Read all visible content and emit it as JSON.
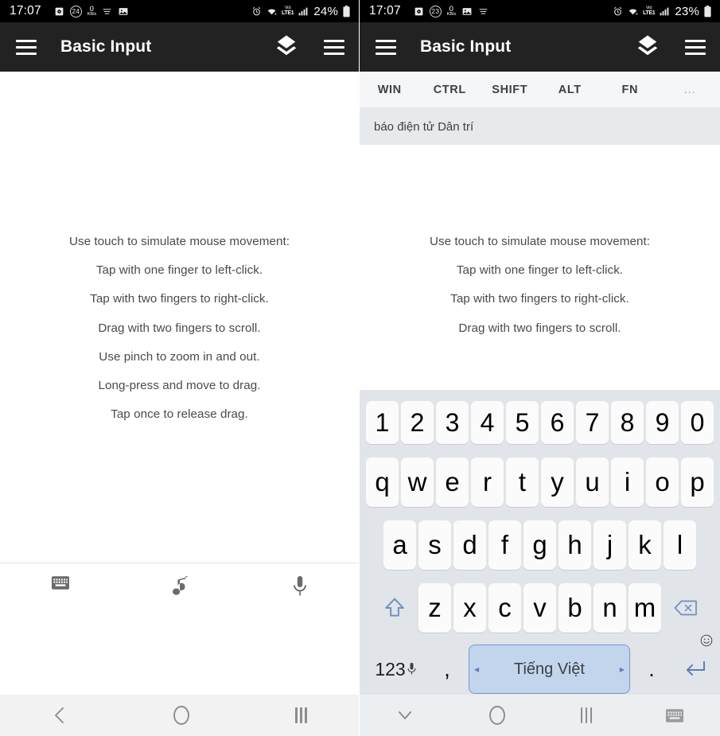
{
  "left": {
    "statusbar": {
      "time": "17:07",
      "alarm_icon": "alarm-clock-icon",
      "badge_count": "24",
      "net_speed_value": "0",
      "net_speed_unit": "KB/s",
      "menu_icon": "list-icon",
      "image_icon": "image-icon",
      "right_alarm_icon": "alarm-icon",
      "wifi_icon": "wifi-icon",
      "volte_top": "Vo)",
      "volte_bottom": "LTE1",
      "signal_icon": "signal-bars-icon",
      "battery_percent": "24%",
      "battery_icon": "battery-icon"
    },
    "appbar": {
      "menu_icon": "hamburger-menu-icon",
      "title": "Basic Input",
      "layers_icon": "layers-icon",
      "overflow_icon": "hamburger-menu-icon"
    },
    "instructions": [
      "Use touch to simulate mouse movement:",
      "Tap with one finger to left-click.",
      "Tap with two fingers to right-click.",
      "Drag with two fingers to scroll.",
      "Use pinch to zoom in and out.",
      "Long-press and move to drag.",
      "Tap once to release drag."
    ],
    "media_toolbar": {
      "keyboard_icon": "keyboard-icon",
      "music_icon": "music-note-icon",
      "mic_icon": "microphone-icon"
    },
    "navbar": {
      "back_icon": "back-chevron-icon",
      "home_icon": "home-circle-icon",
      "recents_icon": "recents-icon"
    }
  },
  "right": {
    "statusbar": {
      "time": "17:07",
      "alarm_icon": "alarm-clock-icon",
      "badge_count": "23",
      "net_speed_value": "0",
      "net_speed_unit": "KB/s",
      "image_icon": "image-icon",
      "menu_icon": "list-icon",
      "right_alarm_icon": "alarm-icon",
      "wifi_icon": "wifi-icon",
      "volte_top": "Vo)",
      "volte_bottom": "LTE1",
      "signal_icon": "signal-bars-icon",
      "battery_percent": "23%",
      "battery_icon": "battery-icon"
    },
    "appbar": {
      "menu_icon": "hamburger-menu-icon",
      "title": "Basic Input",
      "layers_icon": "layers-icon",
      "overflow_icon": "hamburger-menu-icon"
    },
    "modifier_keys": [
      "WIN",
      "CTRL",
      "SHIFT",
      "ALT",
      "FN",
      "..."
    ],
    "suggestion": "báo điện tử Dân trí",
    "instructions": [
      "Use touch to simulate mouse movement:",
      "Tap with one finger to left-click.",
      "Tap with two fingers to right-click.",
      "Drag with two fingers to scroll."
    ],
    "keyboard": {
      "number_row": [
        "1",
        "2",
        "3",
        "4",
        "5",
        "6",
        "7",
        "8",
        "9",
        "0"
      ],
      "row1": [
        "q",
        "w",
        "e",
        "r",
        "t",
        "y",
        "u",
        "i",
        "o",
        "p"
      ],
      "row2": [
        "a",
        "s",
        "d",
        "f",
        "g",
        "h",
        "j",
        "k",
        "l"
      ],
      "row3": [
        "z",
        "x",
        "c",
        "v",
        "b",
        "n",
        "m"
      ],
      "shift_icon": "shift-arrow-icon",
      "backspace_icon": "backspace-icon",
      "numeric_label": "123",
      "numeric_mic_icon": "microphone-icon",
      "comma": ",",
      "space_label": "Tiếng Việt",
      "period": ".",
      "emoji_icon": "emoji-smiley-icon",
      "enter_icon": "enter-return-icon",
      "space_accent_color": "#c3d5ec",
      "space_border_color": "#7698c9"
    },
    "navbar": {
      "dismiss_icon": "chevron-down-icon",
      "home_icon": "home-circle-icon",
      "recents_icon": "recents-icon",
      "keyboard_icon": "keyboard-icon"
    }
  }
}
